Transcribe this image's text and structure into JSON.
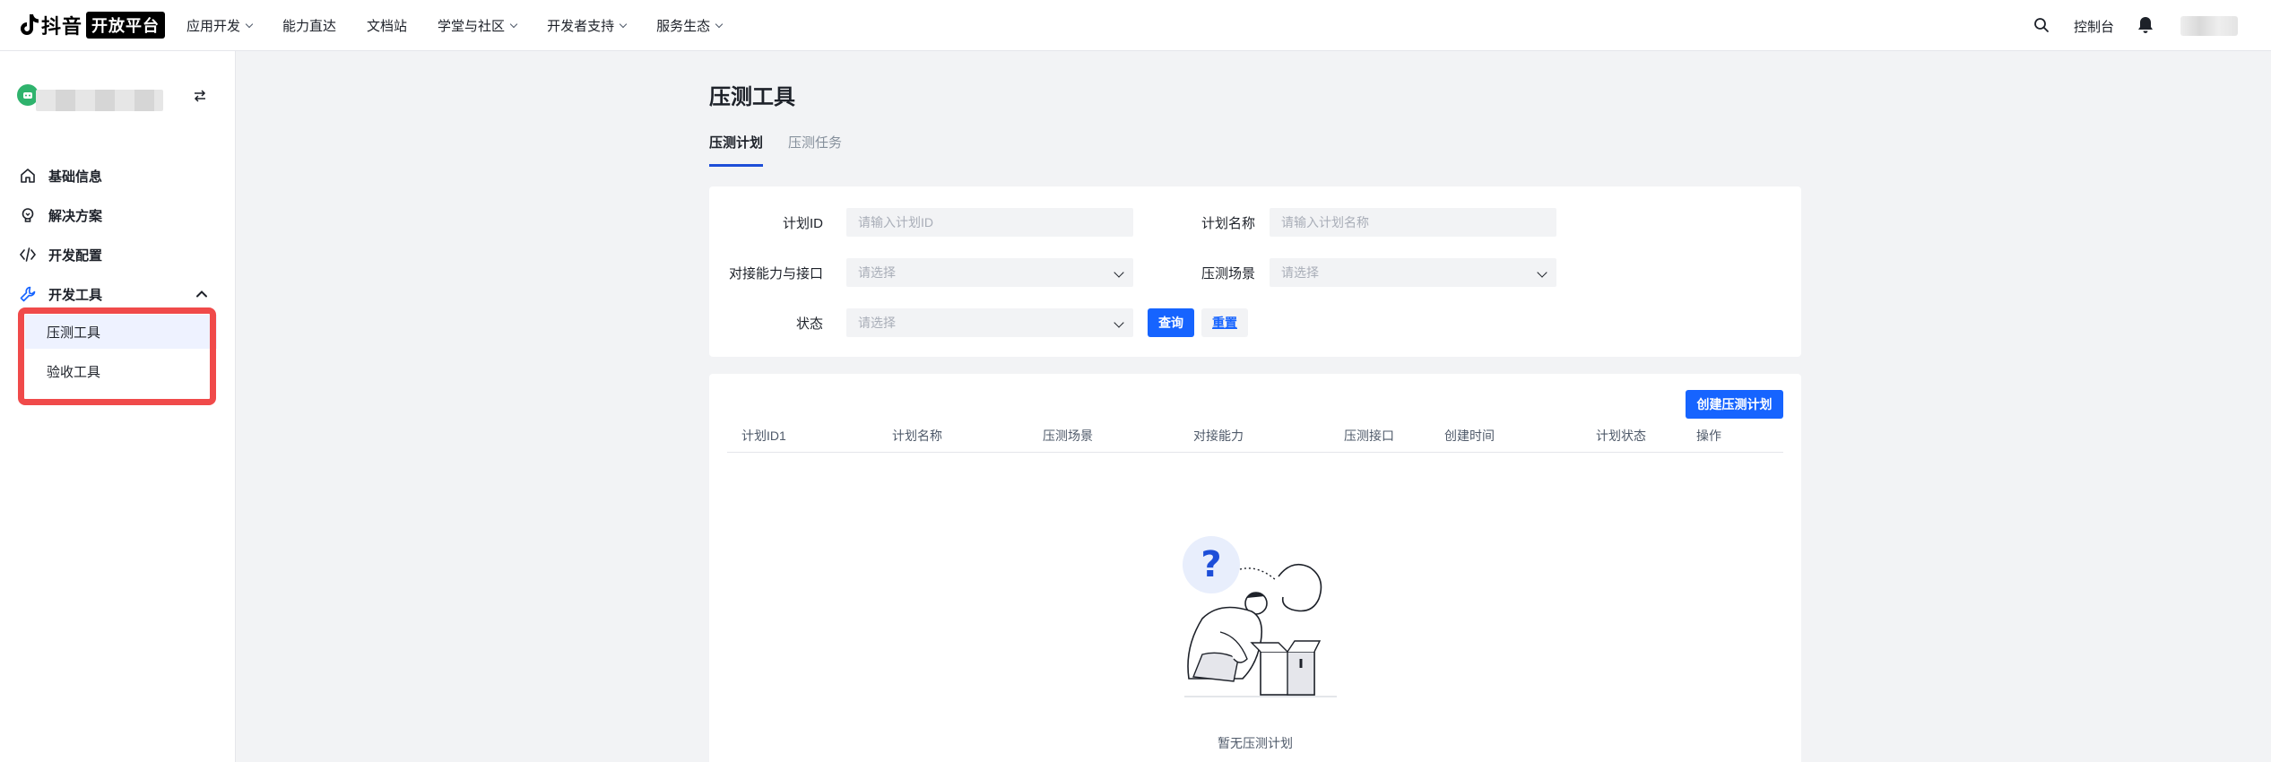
{
  "header": {
    "logo_text": "抖音",
    "logo_badge": "开放平台",
    "nav": [
      {
        "label": "应用开发",
        "has_dropdown": true
      },
      {
        "label": "能力直达",
        "has_dropdown": false
      },
      {
        "label": "文档站",
        "has_dropdown": false
      },
      {
        "label": "学堂与社区",
        "has_dropdown": true
      },
      {
        "label": "开发者支持",
        "has_dropdown": true
      },
      {
        "label": "服务生态",
        "has_dropdown": true
      }
    ],
    "console_label": "控制台"
  },
  "sidebar": {
    "items": [
      {
        "label": "基础信息",
        "icon": "home-icon"
      },
      {
        "label": "解决方案",
        "icon": "lightbulb-icon"
      },
      {
        "label": "开发配置",
        "icon": "code-icon"
      },
      {
        "label": "开发工具",
        "icon": "wrench-icon"
      }
    ],
    "sub_items": [
      {
        "label": "压测工具",
        "selected": true
      },
      {
        "label": "验收工具",
        "selected": false
      }
    ]
  },
  "main": {
    "title": "压测工具",
    "tabs": [
      {
        "label": "压测计划",
        "active": true
      },
      {
        "label": "压测任务",
        "active": false
      }
    ],
    "filters": {
      "plan_id_label": "计划ID",
      "plan_id_placeholder": "请输入计划ID",
      "plan_name_label": "计划名称",
      "plan_name_placeholder": "请输入计划名称",
      "capability_label": "对接能力与接口",
      "capability_placeholder": "请选择",
      "scenario_label": "压测场景",
      "scenario_placeholder": "请选择",
      "status_label": "状态",
      "status_placeholder": "请选择",
      "query_button": "查询",
      "reset_button": "重置"
    },
    "table": {
      "create_button": "创建压测计划",
      "columns": [
        "计划ID1",
        "计划名称",
        "压测场景",
        "对接能力",
        "压测接口",
        "创建时间",
        "计划状态",
        "操作"
      ],
      "empty_text": "暂无压测计划"
    }
  },
  "colors": {
    "primary": "#1664ff",
    "highlight_border": "#f04a4a",
    "background": "#f2f3f5"
  }
}
